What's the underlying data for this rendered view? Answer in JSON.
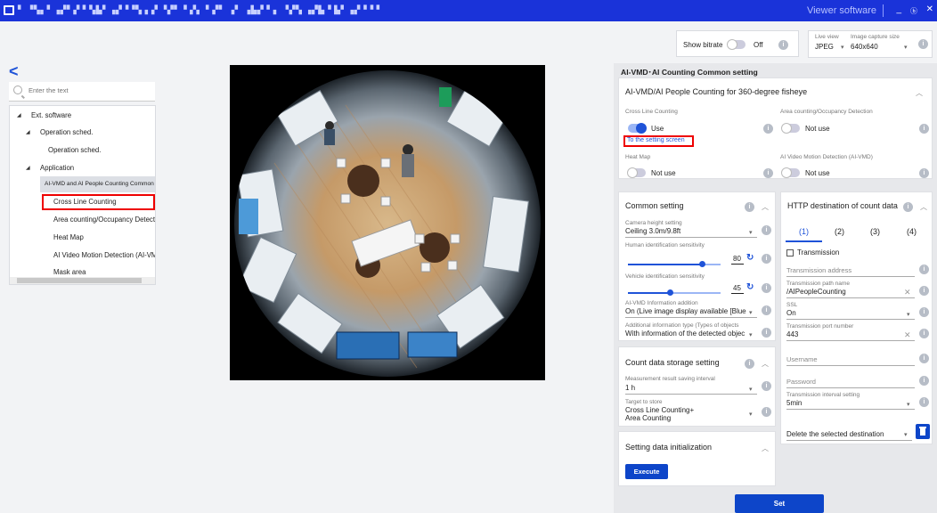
{
  "titlebar": {
    "title": "▘ ▝▚▖▘▗▞▘▞ ▘▚▙▘▗▞▝▝▚ ▖▞ ▝▞▘▝ ▞▖ ▘▞▘ ▗▘ ▗▙▞ ▘▖ ▝▞▚ ▗▞▙▝ ▙▘▗▞▝▝ ▘",
    "brand": "Viewer software",
    "minimize": "_",
    "restore": "ⓑ",
    "close": "✕"
  },
  "bitrate": {
    "label": "Show bitrate",
    "state": "Off"
  },
  "live_view": {
    "label": "Live view",
    "value": "JPEG",
    "capture_label": "Image capture size",
    "capture_value": "640x640"
  },
  "tree": {
    "search_placeholder": "Enter the text",
    "items": [
      {
        "label": "Ext. software"
      },
      {
        "label": "Operation sched."
      },
      {
        "label": "Operation sched."
      },
      {
        "label": "Application"
      },
      {
        "label": "AI-VMD and AI People Counting  Common"
      },
      {
        "label": "Cross Line Counting"
      },
      {
        "label": "Area counting/Occupancy Detecti"
      },
      {
        "label": "Heat Map"
      },
      {
        "label": "AI Video Motion Detection (AI-VMD"
      },
      {
        "label": "Mask area"
      }
    ]
  },
  "panel": {
    "title": "AI-VMD･AI Counting Common setting",
    "fisheye_card": {
      "title": "AI-VMD/AI People Counting for 360-degree fisheye",
      "cross_line": {
        "label": "Cross Line Counting",
        "value": "Use",
        "link": "To the setting screen"
      },
      "area_counting": {
        "label": "Area counting/Occupancy Detection",
        "value": "Not use"
      },
      "heat_map": {
        "label": "Heat Map",
        "value": "Not use"
      },
      "ai_vmd": {
        "label": "AI Video Motion Detection (AI-VMD)",
        "value": "Not use"
      }
    },
    "common": {
      "title": "Common setting",
      "camera_height_label": "Camera height setting",
      "camera_height_value": "Ceiling 3.0m/9.8ft",
      "human_label": "Human identification sensitivity",
      "human_value": "80",
      "human_level": 0.8,
      "vehicle_label": "Vehicle identification sensitivity",
      "vehicle_value": "45",
      "vehicle_level": 0.45,
      "vmd_info_label": "AI-VMD Information addition",
      "vmd_info_value": "On (Live image display available [Blue f",
      "additional_label": "Additional information type (Types of objects",
      "additional_value": "With information of the detected objec"
    },
    "storage": {
      "title": "Count data storage setting",
      "interval_label": "Measurement result saving interval",
      "interval_value": "1 h",
      "target_label": "Target to store",
      "target_value_1": "Cross Line Counting+",
      "target_value_2": "Area Counting"
    },
    "init": {
      "title": "Setting data initialization",
      "execute": "Execute"
    },
    "http": {
      "title": "HTTP destination of count data",
      "tabs": [
        "(1)",
        "(2)",
        "(3)",
        "(4)"
      ],
      "transmission": "Transmission",
      "address_placeholder": "Transmission address",
      "path_label": "Transmission path name",
      "path_value": "/AIPeopleCounting",
      "ssl_label": "SSL",
      "ssl_value": "On",
      "port_label": "Transmission port number",
      "port_value": "443",
      "username_placeholder": "Username",
      "password_placeholder": "Password",
      "interval_label": "Transmission interval setting",
      "interval_value": "5min",
      "delete_label": "Delete the selected destination"
    },
    "set_button": "Set"
  },
  "colors": {
    "titlebar": "#1a33d9",
    "accent": "#1f53d8",
    "button": "#0d45c9",
    "highlight": "#ee0000"
  }
}
